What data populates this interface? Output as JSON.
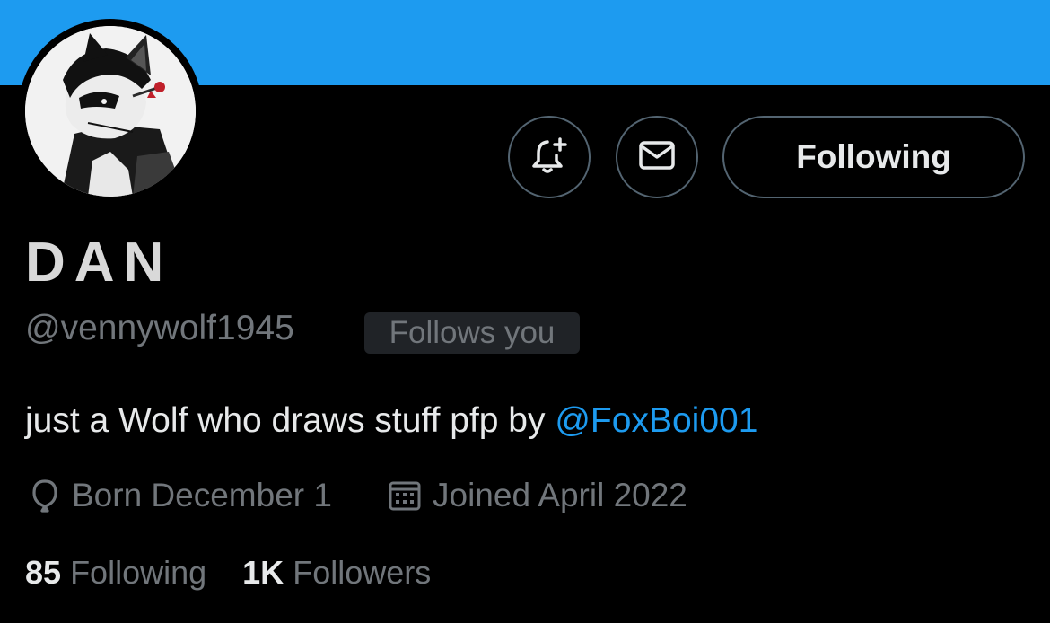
{
  "profile": {
    "display_name": "DAN",
    "handle": "@vennywolf1945",
    "follows_you_badge": "Follows you",
    "bio_text": "just a Wolf who draws stuff pfp by ",
    "bio_mention": "@FoxBoi001",
    "birthday": "Born December 1",
    "joined": "Joined April 2022"
  },
  "actions": {
    "notify_icon": "bell-plus-icon",
    "message_icon": "envelope-icon",
    "follow_label": "Following"
  },
  "stats": {
    "following_count": "85",
    "following_label": "Following",
    "followers_count": "1K",
    "followers_label": "Followers"
  },
  "colors": {
    "banner": "#1d9bf0",
    "background": "#000000",
    "link": "#1d9bf0",
    "muted_text": "#71767b"
  }
}
